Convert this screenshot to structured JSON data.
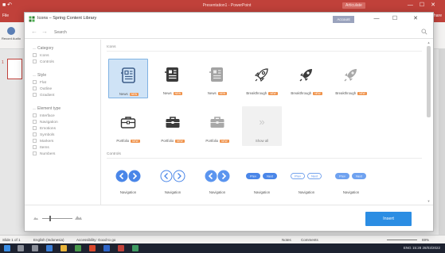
{
  "powerpoint": {
    "title": "Presentation1 - PowerPoint",
    "account": "Articulate",
    "file_tab": "File",
    "share": "Share",
    "record_label": "Record Audio",
    "slide_number": "1",
    "status": {
      "slide": "Slide 1 of 1",
      "language": "English (Indonesia)",
      "accessibility": "Accessibility: Good to go",
      "notes": "Notes",
      "comments": "Comments",
      "zoom": "69%"
    },
    "taskbar": {
      "lang": "ENG",
      "time": "15:28",
      "date": "28/03/2022"
    }
  },
  "dialog": {
    "title": "Icons – Spring Content Library",
    "account": "Account",
    "search_placeholder": "Search",
    "sidebar": {
      "category": {
        "heading": "Category",
        "items": [
          "Icons",
          "Controls"
        ]
      },
      "style": {
        "heading": "Style",
        "items": [
          "Flat",
          "Outline",
          "Gradient"
        ]
      },
      "element_type": {
        "heading": "Element type",
        "items": [
          "Interface",
          "Navigation",
          "Emotions",
          "Symbols",
          "Markers",
          "Items",
          "Numbers"
        ]
      }
    },
    "sections": {
      "icons": {
        "title": "Icons",
        "tiles": [
          {
            "label": "News",
            "new": "NEW"
          },
          {
            "label": "News",
            "new": "NEW"
          },
          {
            "label": "News",
            "new": "NEW"
          },
          {
            "label": "Breakthrough",
            "new": "NEW"
          },
          {
            "label": "Breakthrough",
            "new": "NEW"
          },
          {
            "label": "Breakthrough",
            "new": "NEW"
          },
          {
            "label": "Portfolio",
            "new": "NEW"
          },
          {
            "label": "Portfolio",
            "new": "NEW"
          },
          {
            "label": "Portfolio",
            "new": "NEW"
          }
        ],
        "show_all": "Show all"
      },
      "controls": {
        "title": "Controls",
        "tiles": [
          {
            "label": "Navigation",
            "prev": "Prev",
            "next": "Next"
          },
          {
            "label": "Navigation",
            "prev": "Prev",
            "next": "Next"
          },
          {
            "label": "Navigation",
            "prev": "Prev",
            "next": "Next"
          },
          {
            "label": "Navigation",
            "prev": "Prev",
            "next": "Next"
          },
          {
            "label": "Navigation",
            "prev": "Prev",
            "next": "Next"
          },
          {
            "label": "Navigation",
            "prev": "Prev",
            "next": "Next"
          }
        ]
      }
    },
    "insert_label": "Insert"
  },
  "colors": {
    "ppt_red": "#c0413a",
    "accent_blue": "#2b8de3",
    "selected_bg": "#cfe3f6",
    "new_badge": "#f0924a",
    "icon_dark": "#444444",
    "icon_mid": "#6e6e6e",
    "icon_light": "#a8a8a8",
    "nav_blue": "#4a86e8"
  }
}
